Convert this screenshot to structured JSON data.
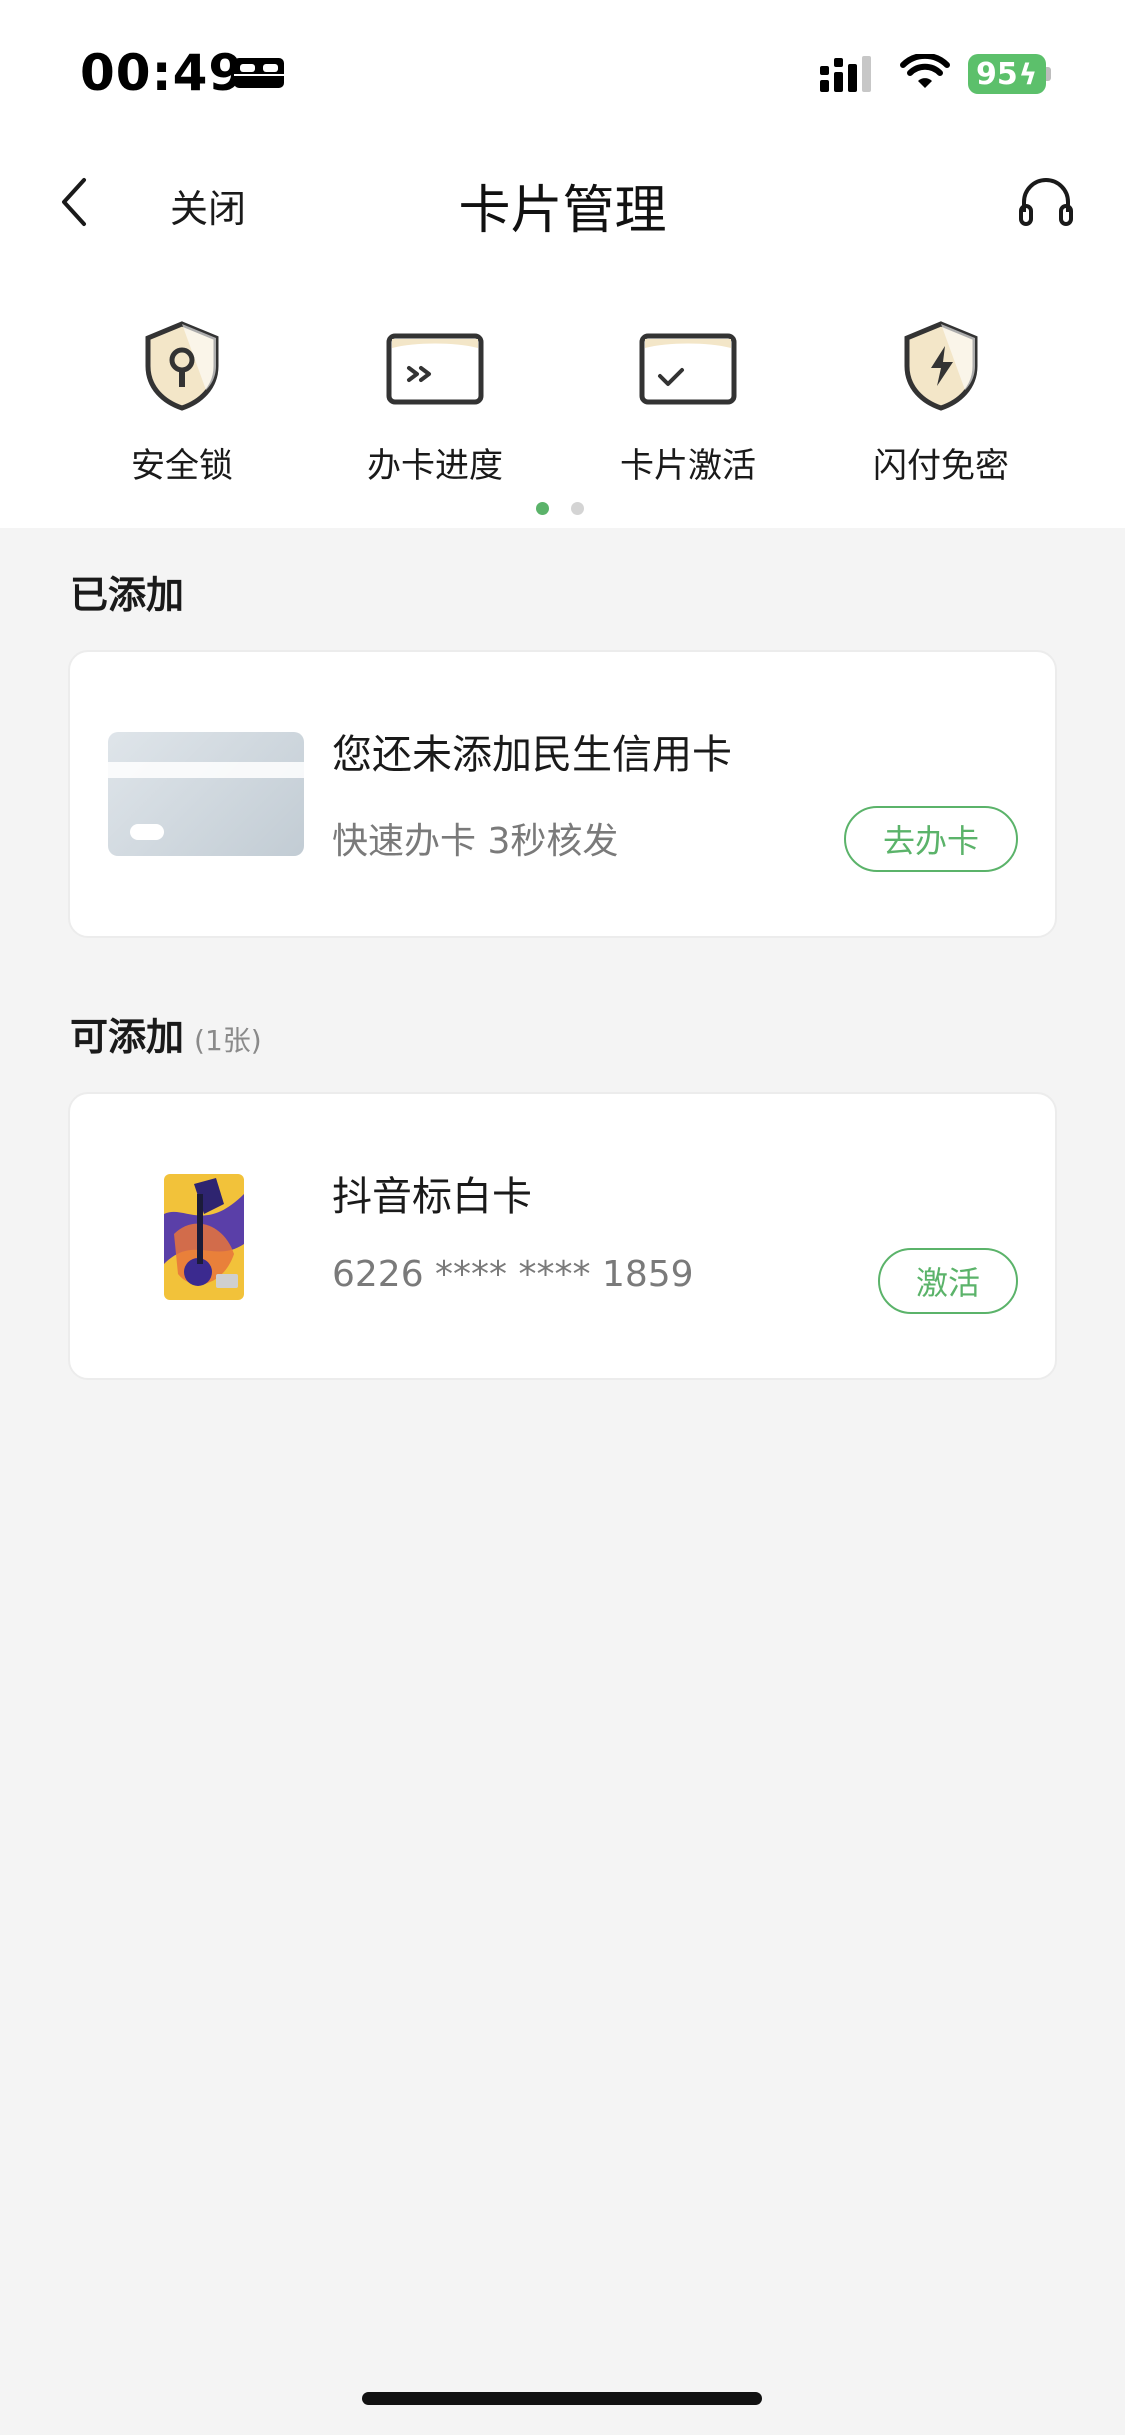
{
  "status_bar": {
    "time": "00:49",
    "battery_level": "95",
    "icons": [
      "bed-icon",
      "cellular-signal-icon",
      "wifi-icon",
      "battery-charging-icon"
    ]
  },
  "nav": {
    "back_icon": "chevron-left-icon",
    "close_label": "关闭",
    "title": "卡片管理",
    "support_icon": "headset-icon"
  },
  "quick_actions": [
    {
      "label": "安全锁",
      "icon": "shield-lock-icon"
    },
    {
      "label": "办卡进度",
      "icon": "card-progress-icon"
    },
    {
      "label": "卡片激活",
      "icon": "card-activate-icon"
    },
    {
      "label": "闪付免密",
      "icon": "shield-lightning-icon"
    }
  ],
  "pager": {
    "pages": 2,
    "active": 0
  },
  "added_section": {
    "title": "已添加",
    "card": {
      "title": "您还未添加民生信用卡",
      "subtitle": "快速办卡 3秒核发",
      "button": "去办卡"
    }
  },
  "addable_section": {
    "title": "可添加",
    "count": "(1张)",
    "card": {
      "title": "抖音标白卡",
      "number": "6226 **** **** 1859",
      "button": "激活"
    }
  },
  "colors": {
    "accent_green": "#5bb36a",
    "background": "#f4f4f4",
    "battery_green": "#5cc06b"
  }
}
